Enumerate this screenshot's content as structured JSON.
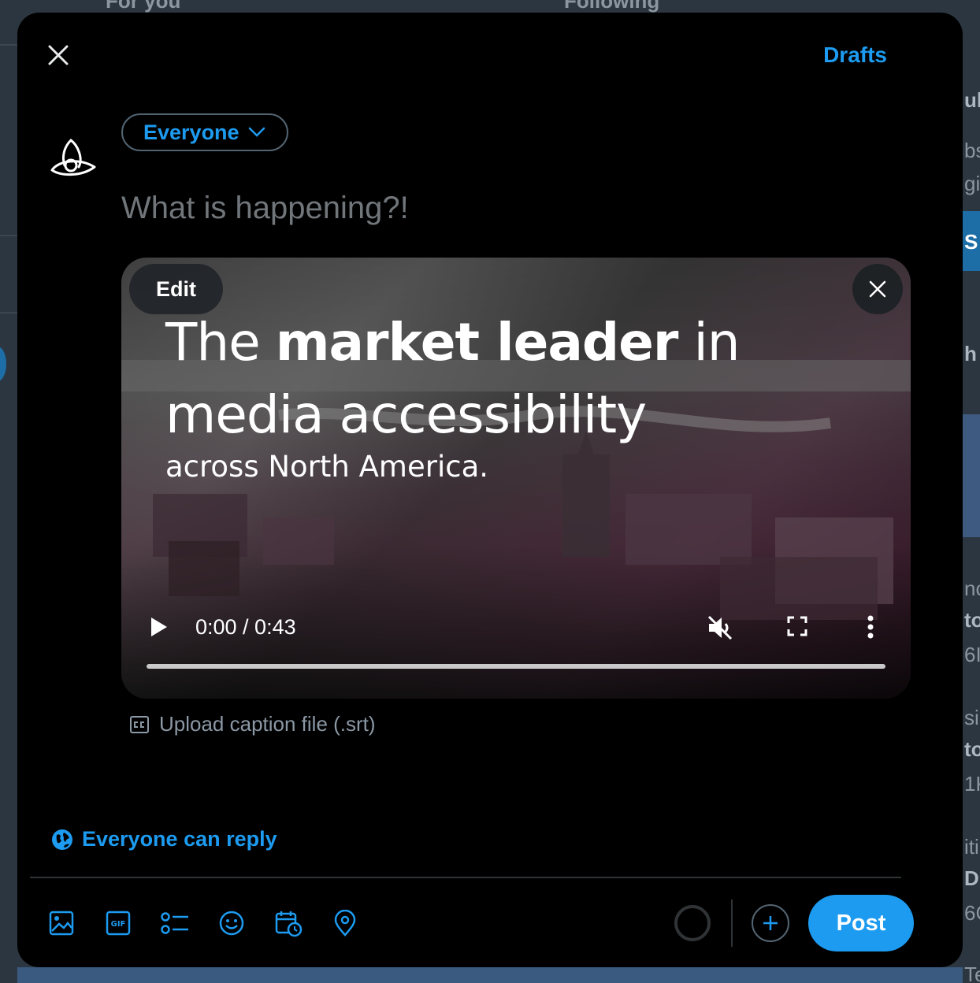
{
  "background": {
    "tabs": [
      "For you",
      "Following"
    ],
    "right_fragments": [
      "ul",
      "bs",
      "gi",
      "S",
      "h",
      "nc",
      "to",
      "6I",
      "si",
      "to",
      "1K",
      "iti",
      "D I",
      "6C",
      "Tec"
    ]
  },
  "header": {
    "drafts_label": "Drafts"
  },
  "composer": {
    "audience_label": "Everyone",
    "placeholder": "What is happening?!"
  },
  "media": {
    "edit_label": "Edit",
    "headline_pre": "The ",
    "headline_bold": "market leader",
    "headline_post": " in",
    "headline_line2": "media accessibility",
    "subline": "across North America.",
    "time_display": "0:00 / 0:43",
    "progress_fraction": 0.0
  },
  "caption": {
    "upload_label": "Upload caption file (.srt)"
  },
  "reply_setting": {
    "label": "Everyone can reply"
  },
  "toolbar": {
    "icons": [
      "image-icon",
      "gif-icon",
      "poll-icon",
      "emoji-icon",
      "schedule-icon",
      "location-icon"
    ],
    "post_label": "Post"
  },
  "colors": {
    "accent": "#1d9bf0",
    "modal_bg": "#000000",
    "muted_text": "#71767b"
  }
}
